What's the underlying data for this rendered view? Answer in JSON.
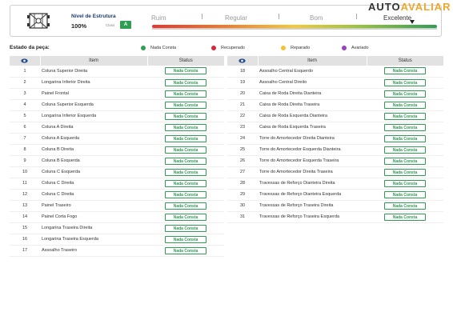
{
  "header": {
    "nivel_title": "Nível de Estrutura",
    "nivel_value": "100%",
    "classe_label": "Class",
    "classe_value": "A",
    "scale": [
      "Ruim",
      "Regular",
      "Bom",
      "Excelente"
    ],
    "active_scale": "Excelente",
    "logo_part1": "AUTO",
    "logo_part2": "AVALIAR"
  },
  "legend": {
    "title": "Estado da peça:",
    "items": [
      {
        "label": "Nada Consta",
        "color": "#2f9e54"
      },
      {
        "label": "Recuperado",
        "color": "#d9263b"
      },
      {
        "label": "Reparado",
        "color": "#f2c230"
      },
      {
        "label": "Avariado",
        "color": "#9b3fc2"
      }
    ]
  },
  "table": {
    "col_item": "Item",
    "col_status": "Status"
  },
  "left_rows": [
    {
      "n": "1",
      "item": "Coluna Superior Direita",
      "status": "Nada Consta"
    },
    {
      "n": "2",
      "item": "Longarina Inferior Direita",
      "status": "Nada Consta"
    },
    {
      "n": "3",
      "item": "Painel Frontal",
      "status": "Nada Consta"
    },
    {
      "n": "4",
      "item": "Coluna Superior Esquerda",
      "status": "Nada Consta"
    },
    {
      "n": "5",
      "item": "Longarina Inferior Esquerda",
      "status": "Nada Consta"
    },
    {
      "n": "6",
      "item": "Coluna A Direita",
      "status": "Nada Consta"
    },
    {
      "n": "7",
      "item": "Coluna A Esquerda",
      "status": "Nada Consta"
    },
    {
      "n": "8",
      "item": "Coluna B Direita",
      "status": "Nada Consta"
    },
    {
      "n": "9",
      "item": "Coluna B Esquerda",
      "status": "Nada Consta"
    },
    {
      "n": "10",
      "item": "Coluna C Esquerda",
      "status": "Nada Consta"
    },
    {
      "n": "11",
      "item": "Coluna C Direita",
      "status": "Nada Consta"
    },
    {
      "n": "12",
      "item": "Coluna C Direita",
      "status": "Nada Consta"
    },
    {
      "n": "13",
      "item": "Painel Traseiro",
      "status": "Nada Consta"
    },
    {
      "n": "14",
      "item": "Painel Corta Fogo",
      "status": "Nada Consta"
    },
    {
      "n": "15",
      "item": "Longarina Traseira Direita",
      "status": "Nada Consta"
    },
    {
      "n": "16",
      "item": "Longarina Traseira Esquerda",
      "status": "Nada Consta"
    },
    {
      "n": "17",
      "item": "Assoalho Traseiro",
      "status": "Nada Consta"
    }
  ],
  "right_rows": [
    {
      "n": "18",
      "item": "Assoalho Central Esquerdo",
      "status": "Nada Consta"
    },
    {
      "n": "19",
      "item": "Assoalho Central Direito",
      "status": "Nada Consta"
    },
    {
      "n": "20",
      "item": "Caixa de Roda Direita Dianteira",
      "status": "Nada Consta"
    },
    {
      "n": "21",
      "item": "Caixa de Roda Direita Traseira",
      "status": "Nada Consta"
    },
    {
      "n": "22",
      "item": "Caixa de Roda Esquerda Dianteira",
      "status": "Nada Consta"
    },
    {
      "n": "23",
      "item": "Caixa de Roda Esquerda Traseira",
      "status": "Nada Consta"
    },
    {
      "n": "24",
      "item": "Torre do Amortecedor Direita Dianteira",
      "status": "Nada Consta"
    },
    {
      "n": "25",
      "item": "Torre do Amortecedor Esquerda Dianteira",
      "status": "Nada Consta"
    },
    {
      "n": "26",
      "item": "Torre do Amortecedor Esquerda Traseira",
      "status": "Nada Consta"
    },
    {
      "n": "27",
      "item": "Torre do Amortecedor Direita Traseira",
      "status": "Nada Consta"
    },
    {
      "n": "28",
      "item": "Travessas de Reforço Dianteira Direita",
      "status": "Nada Consta"
    },
    {
      "n": "29",
      "item": "Travessas de Reforço Dianteira Esquerda",
      "status": "Nada Consta"
    },
    {
      "n": "30",
      "item": "Travessas de Reforço Traseira Direita",
      "status": "Nada Consta"
    },
    {
      "n": "31",
      "item": "Travessas de Reforço Traseira Esquerda",
      "status": "Nada Consta"
    }
  ]
}
